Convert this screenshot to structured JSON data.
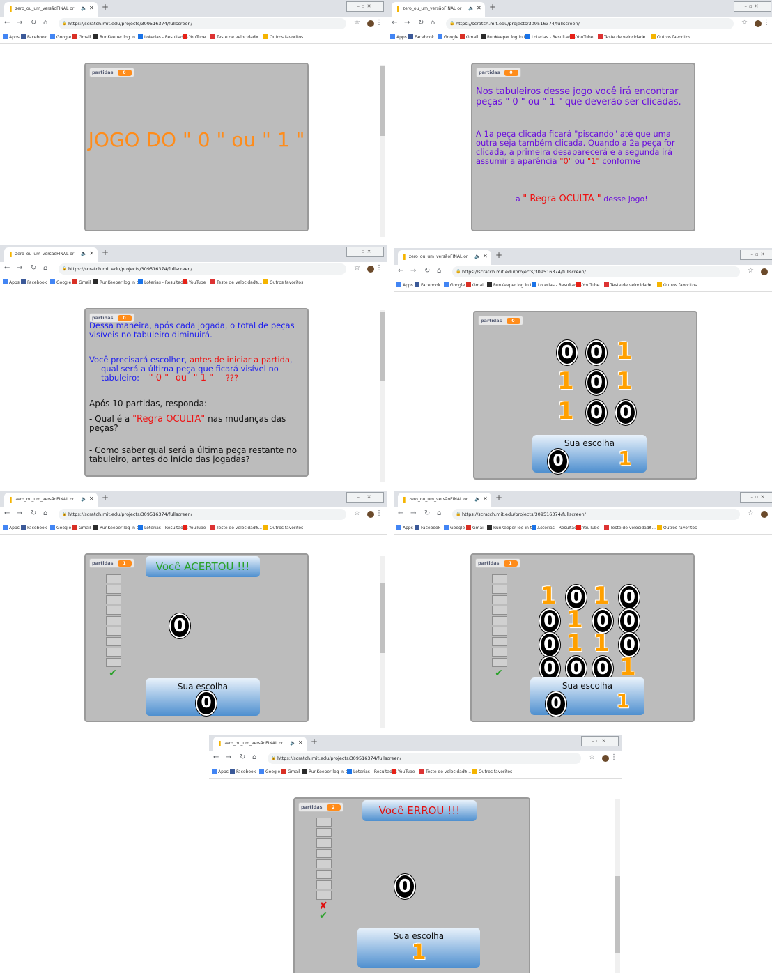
{
  "browser": {
    "tab_title": "zero_ou_um_versãoFINAL on Scr",
    "tab_title_short": "zero_ou_um_versãoFINAL or",
    "url": "https://scratch.mit.edu/projects/309516374/fullscreen/",
    "bookmarks": [
      "Apps",
      "Facebook",
      "Google",
      "Gmail",
      "RunKeeper log in to...",
      "Loterias - Resultados",
      "YouTube",
      "Teste de velocidade...",
      "»",
      "Outros favoritos"
    ]
  },
  "colors": {
    "orange": "#ff8c1a",
    "stage": "#bcbcbc",
    "blue_text": "#1e1eee",
    "purple_text": "#6a0ddd",
    "red_text": "#ee1111"
  },
  "var_label": "partidas",
  "choice_label": "Sua escolha",
  "screens": {
    "s1": {
      "partidas": "0",
      "title": "JOGO DO \" 0 \" ou \" 1 \""
    },
    "s2": {
      "partidas": "0",
      "p1": "Nos tabuleiros desse jogo você irá encontrar peças \" 0 \" ou \" 1 \" que deverão ser clicadas.",
      "p2_a": "A 1a peça clicada ficará \"piscando\" até que uma outra seja também clicada. Quando a 2a peça for clicada, a primeira desaparecerá e a segunda irá assumir a aparência",
      "p2_b": "\"0\"",
      "p2_c": "ou",
      "p2_d": "\"1\"",
      "p2_e": "conforme",
      "p3_a": "a",
      "p3_b": "\" Regra OCULTA \"",
      "p3_c": "desse jogo!"
    },
    "s3": {
      "partidas": "0",
      "l1": "Dessa maneira, após cada jogada, o total de peças visíveis no tabuleiro diminuirá.",
      "l2_a": "Você precisará escolher,",
      "l2_b": "antes de iniciar a partida",
      "l2_c": ",",
      "l3": "qual será a última peça que ficará visível no tabuleiro:",
      "l3_q0": "\" 0 \"",
      "l3_or": "ou",
      "l3_q1": "\" 1 \"",
      "l3_qq": "???",
      "l4": "Após 10 partidas, responda:",
      "l5_a": "- Qual é a",
      "l5_b": "\"Regra OCULTA\"",
      "l5_c": "nas mudanças das peças?",
      "l6": "- Como saber qual será a última peça restante no tabuleiro, antes do início das jogadas?"
    },
    "s4": {
      "partidas": "0",
      "grid": [
        [
          "0",
          "0",
          "1"
        ],
        [
          "1",
          "0",
          "1"
        ],
        [
          "1",
          "0",
          "0"
        ]
      ],
      "choice0": "0",
      "choice1": "1"
    },
    "s5": {
      "partidas": "1",
      "banner": "Você ACERTOU !!!",
      "piece": "0",
      "selected": "0",
      "marks": [
        "✔"
      ]
    },
    "s6": {
      "partidas": "1",
      "grid": [
        [
          "1",
          "0",
          "1",
          "0"
        ],
        [
          "0",
          "1",
          "0",
          "0"
        ],
        [
          "0",
          "1",
          "1",
          "0"
        ],
        [
          "0",
          "0",
          "0",
          "1"
        ]
      ],
      "choice0": "0",
      "choice1": "1",
      "marks": [
        "✔"
      ]
    },
    "s7": {
      "partidas": "2",
      "banner": "Você  ERROU  !!!",
      "piece": "0",
      "selected": "1",
      "marks": [
        "✘",
        "✔"
      ]
    }
  }
}
